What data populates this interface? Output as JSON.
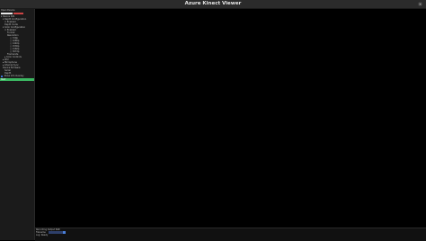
{
  "window": {
    "title": "Azure Kinect Viewer",
    "close_glyph": "×"
  },
  "sidebar": {
    "header": "Open Device",
    "field_value": "",
    "tree": [
      {
        "label": "▾ Device S/N",
        "level": 0
      },
      {
        "label": "▾ Depth Configuration",
        "level": 1
      },
      {
        "label": "☐ Enabled",
        "level": 2
      },
      {
        "label": "Depth mode",
        "level": 2
      },
      {
        "label": "▾ Color Configuration",
        "level": 1
      },
      {
        "label": "☐ Enabled",
        "level": 2
      },
      {
        "label": "Format",
        "level": 3
      },
      {
        "label": "Resolution",
        "level": 3
      },
      {
        "label": "○ 720p",
        "level": 4
      },
      {
        "label": "○ 1080p",
        "level": 4
      },
      {
        "label": "○ 1440p",
        "level": 4
      },
      {
        "label": "○ 1536p",
        "level": 4
      },
      {
        "label": "○ 2160p",
        "level": 4
      },
      {
        "label": "○ 3072p",
        "level": 4
      },
      {
        "label": "Framerate",
        "level": 3
      },
      {
        "label": "▸ Color Controls",
        "level": 2
      },
      {
        "label": "▸ IMU",
        "level": 1
      },
      {
        "label": "▸ Microphone",
        "level": 1
      },
      {
        "label": "▸ Internal Sync",
        "level": 1
      },
      {
        "label": "Device firmware",
        "level": 1
      },
      {
        "label": "Serial",
        "level": 2
      },
      {
        "label": "Depth",
        "level": 2
      }
    ],
    "sq_label": "Show Info Overlay",
    "green_button": "Start"
  },
  "bottom": {
    "line1": "Recording   Output Path",
    "line2": "Filename",
    "line3": "Log: Ready"
  }
}
